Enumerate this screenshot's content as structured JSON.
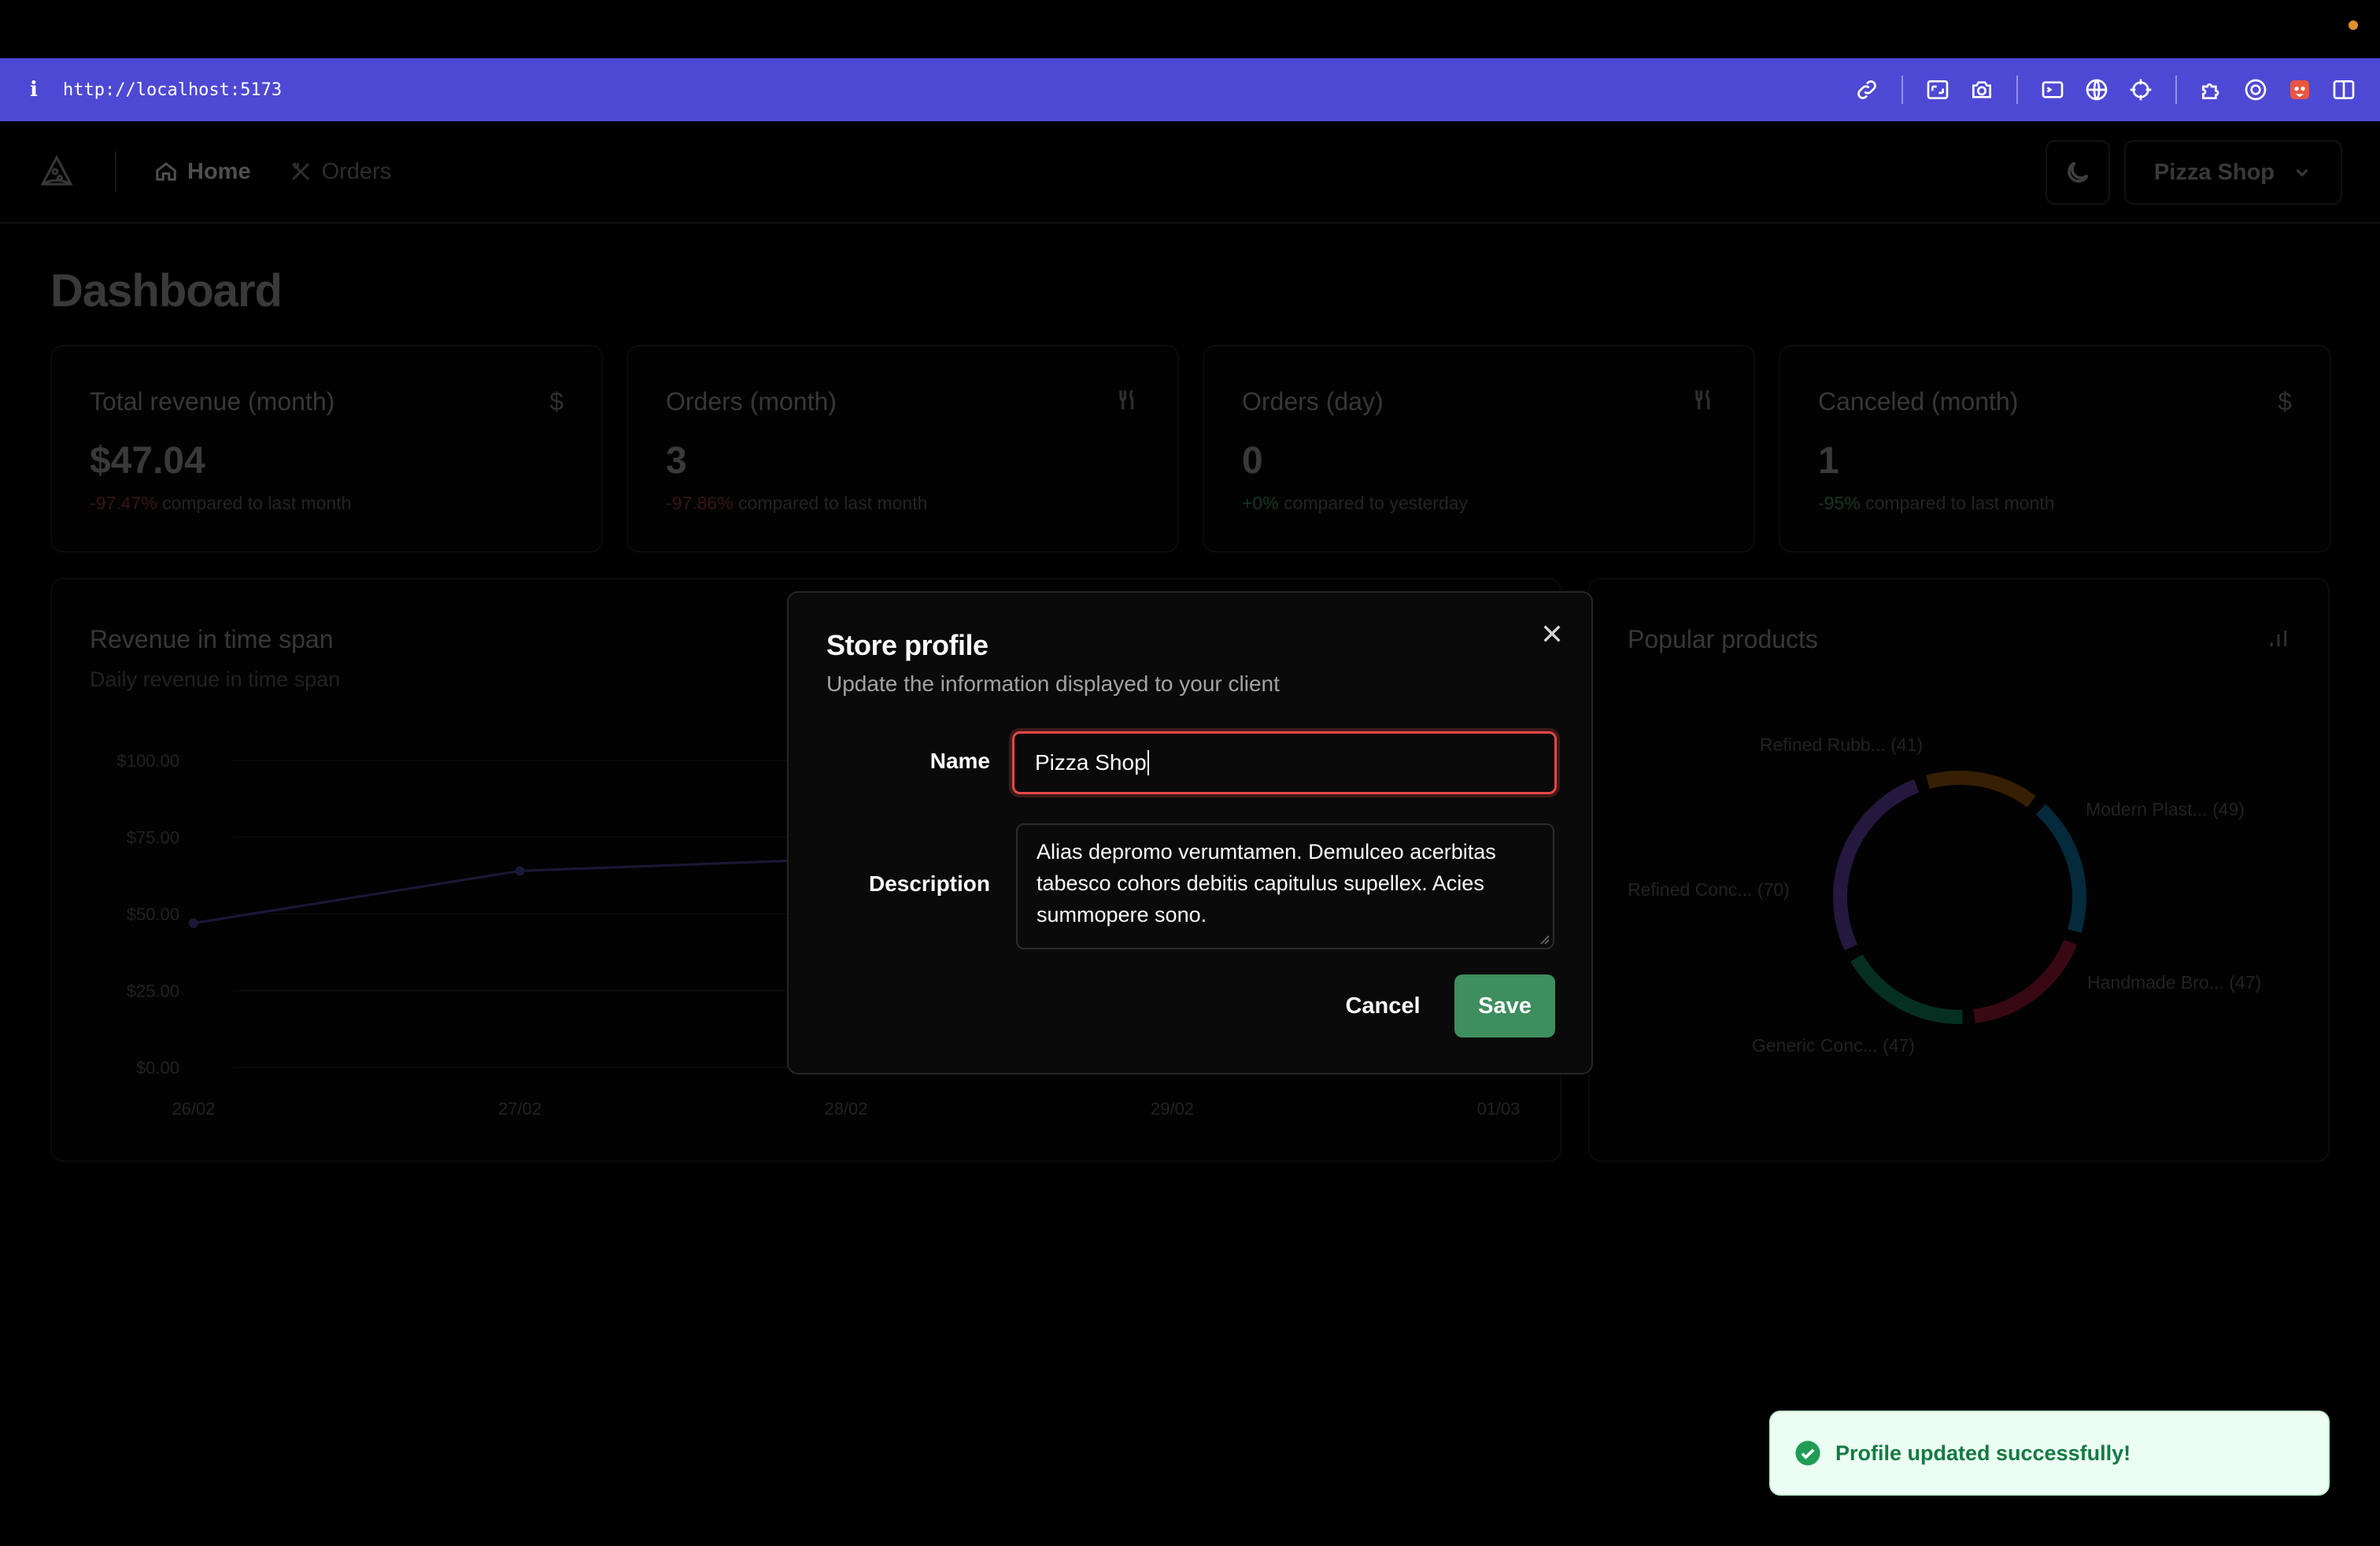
{
  "browser": {
    "info_glyph": "i",
    "url": "http://localhost:5173",
    "tool_icons": [
      "link-icon",
      "screenshot-icon",
      "camera-icon",
      "terminal-icon",
      "globe-icon",
      "crosshair-icon",
      "extensions-icon",
      "record-icon",
      "fox-icon",
      "split-view-icon"
    ]
  },
  "header": {
    "nav": [
      {
        "label": "Home",
        "icon": "home-icon"
      },
      {
        "label": "Orders",
        "icon": "utensils-icon"
      }
    ],
    "store_menu_label": "Pizza Shop"
  },
  "dashboard": {
    "title": "Dashboard",
    "stats": [
      {
        "label": "Total revenue (month)",
        "icon": "$",
        "value": "$47.04",
        "change": "-97.47%",
        "change_tone": "negative",
        "suffix": "compared to last month"
      },
      {
        "label": "Orders (month)",
        "icon": "utensils-icon",
        "value": "3",
        "change": "-97.86%",
        "change_tone": "negative",
        "suffix": "compared to last month"
      },
      {
        "label": "Orders (day)",
        "icon": "utensils-icon",
        "value": "0",
        "change": "+0%",
        "change_tone": "positive",
        "suffix": "compared to yesterday"
      },
      {
        "label": "Canceled (month)",
        "icon": "$",
        "value": "1",
        "change": "-95%",
        "change_tone": "positive",
        "suffix": "compared to last month"
      }
    ],
    "revenue_chart": {
      "title": "Revenue in time span",
      "subtitle": "Daily revenue in time span"
    },
    "popular_products": {
      "title": "Popular products"
    }
  },
  "chart_data": [
    {
      "type": "line",
      "title": "Revenue in time span",
      "xlabel": "",
      "ylabel": "",
      "categories": [
        "26/02",
        "27/02",
        "28/02",
        "29/02",
        "01/03"
      ],
      "y_ticks": [
        "$100.00",
        "$75.00",
        "$50.00",
        "$25.00",
        "$0.00"
      ],
      "ylim": [
        0,
        100
      ],
      "series": [
        {
          "values": [
            47,
            64,
            68,
            null,
            null
          ]
        }
      ],
      "grid": true,
      "line_color": "#8b5cf6"
    },
    {
      "type": "pie",
      "title": "Popular products",
      "donut": true,
      "labels": [
        "Refined Rubb...",
        "Modern Plast...",
        "Handmade Bro...",
        "Generic Conc...",
        "Refined Conc..."
      ],
      "values": [
        41,
        49,
        47,
        47,
        70
      ],
      "colors": [
        "#d97706",
        "#0ea5e9",
        "#e11d48",
        "#10b981",
        "#8b5cf6"
      ]
    }
  ],
  "modal": {
    "title": "Store profile",
    "description": "Update the information displayed to your client",
    "name_label": "Name",
    "name_value": "Pizza Shop",
    "description_label": "Description",
    "description_value": "Alias depromo verumtamen. Demulceo acerbitas tabesco cohors debitis capitulus supellex. Acies summopere sono.",
    "cancel_label": "Cancel",
    "save_label": "Save"
  },
  "toast": {
    "message": "Profile updated successfully!",
    "status_color": "#137a43"
  }
}
